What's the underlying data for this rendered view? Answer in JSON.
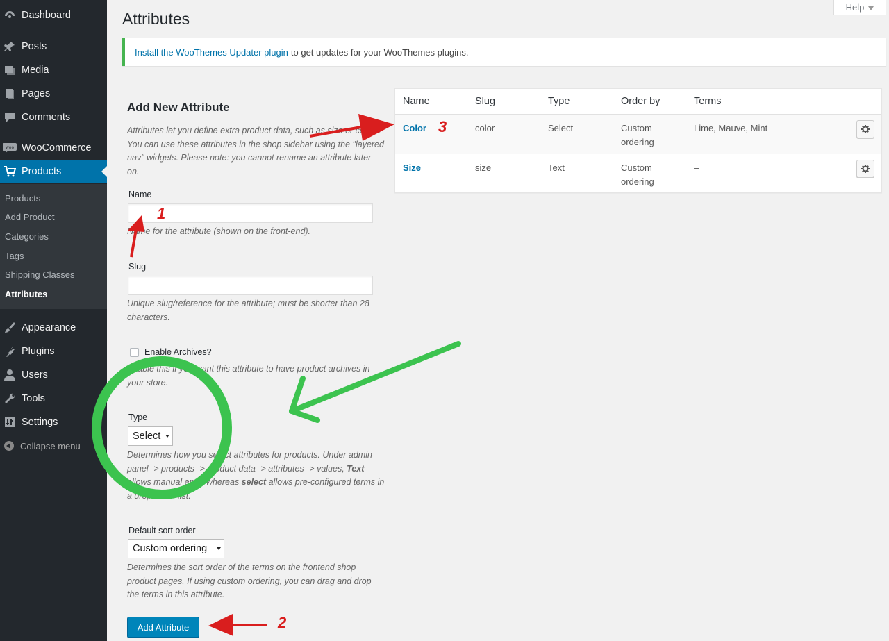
{
  "sidebar": {
    "items": [
      {
        "label": "Dashboard",
        "icon": "dashboard-icon"
      },
      {
        "label": "Posts",
        "icon": "pin-icon"
      },
      {
        "label": "Media",
        "icon": "media-icon"
      },
      {
        "label": "Pages",
        "icon": "pages-icon"
      },
      {
        "label": "Comments",
        "icon": "comments-icon"
      },
      {
        "label": "WooCommerce",
        "icon": "woo-icon"
      },
      {
        "label": "Products",
        "icon": "cart-icon"
      },
      {
        "label": "Appearance",
        "icon": "brush-icon"
      },
      {
        "label": "Plugins",
        "icon": "plugin-icon"
      },
      {
        "label": "Users",
        "icon": "user-icon"
      },
      {
        "label": "Tools",
        "icon": "wrench-icon"
      },
      {
        "label": "Settings",
        "icon": "settings-icon"
      }
    ],
    "submenu": [
      "Products",
      "Add Product",
      "Categories",
      "Tags",
      "Shipping Classes",
      "Attributes"
    ],
    "collapse_label": "Collapse menu"
  },
  "header": {
    "title": "Attributes",
    "help_label": "Help"
  },
  "notice": {
    "link_text": "Install the WooThemes Updater plugin",
    "text": "to get updates for your WooThemes plugins."
  },
  "form": {
    "heading": "Add New Attribute",
    "intro": "Attributes let you define extra product data, such as size or colour. You can use these attributes in the shop sidebar using the \"layered nav\" widgets. Please note: you cannot rename an attribute later on.",
    "name_label": "Name",
    "name_value": "",
    "name_desc": "Name for the attribute (shown on the front-end).",
    "slug_label": "Slug",
    "slug_value": "",
    "slug_desc": "Unique slug/reference for the attribute; must be shorter than 28 characters.",
    "archives_label": "Enable Archives?",
    "archives_desc": "Enable this if you want this attribute to have product archives in your store.",
    "type_label": "Type",
    "type_value": "Select",
    "type_desc_1": "Determines how you select attributes for products. Under admin panel -> products -> product data -> attributes -> values, ",
    "type_desc_text": "Text",
    "type_desc_2": " allows manual entry whereas ",
    "type_desc_select": "select",
    "type_desc_3": " allows pre-configured terms in a drop-down list.",
    "sort_label": "Default sort order",
    "sort_value": "Custom ordering",
    "sort_desc": "Determines the sort order of the terms on the frontend shop product pages. If using custom ordering, you can drag and drop the terms in this attribute.",
    "submit_label": "Add Attribute"
  },
  "table": {
    "headers": [
      "Name",
      "Slug",
      "Type",
      "Order by",
      "Terms"
    ],
    "rows": [
      {
        "name": "Color",
        "slug": "color",
        "type": "Select",
        "order1": "Custom",
        "order2": "ordering",
        "terms": "Lime, Mauve, Mint"
      },
      {
        "name": "Size",
        "slug": "size",
        "type": "Text",
        "order1": "Custom",
        "order2": "ordering",
        "terms": "–"
      }
    ]
  },
  "annotations": {
    "labels": [
      "1",
      "2",
      "3"
    ],
    "colors": {
      "red": "#d91e1e",
      "green": "#3cc34f"
    }
  }
}
